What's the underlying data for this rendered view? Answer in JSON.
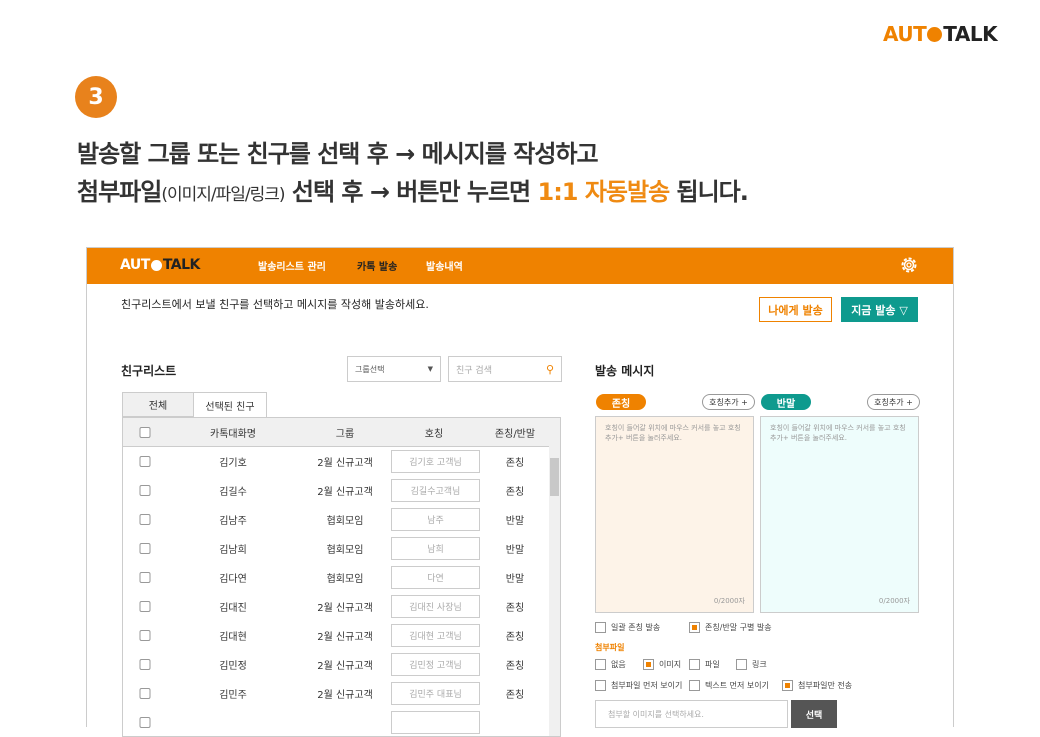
{
  "brand": {
    "logo_left": "AUT",
    "logo_right": "TALK"
  },
  "step": "3",
  "headline": {
    "line1": "발송할 그룹 또는 친구를 선택 후 → 메시지를 작성하고",
    "line2_a": "첨부파일",
    "line2_small": "(이미지/파일/링크)",
    "line2_b": " 선택 후 → 버튼만 누르면 ",
    "line2_highlight": "1:1 자동발송",
    "line2_c": " 됩니다."
  },
  "app": {
    "nav": [
      {
        "label": "발송리스트 관리"
      },
      {
        "label": "카톡 발송"
      },
      {
        "label": "발송내역"
      }
    ],
    "instruction": "친구리스트에서 보낼 친구를 선택하고 메시지를 작성해 발송하세요.",
    "send_me_label": "나에게 발송",
    "send_now_label": "지금 발송 ▽",
    "friend_list": {
      "title": "친구리스트",
      "group_select": "그룹선택",
      "search_placeholder": "친구 검색",
      "tabs": [
        {
          "label": "전체"
        },
        {
          "label": "선택된 친구"
        }
      ],
      "columns": [
        "카톡대화명",
        "그룹",
        "호칭",
        "존칭/반말"
      ],
      "rows": [
        {
          "name": "김기호",
          "group": "2월 신규고객",
          "honorific": "김기호 고객님",
          "tone": "존칭"
        },
        {
          "name": "김길수",
          "group": "2월 신규고객",
          "honorific": "김길수고객님",
          "tone": "존칭"
        },
        {
          "name": "김남주",
          "group": "협회모임",
          "honorific": "남주",
          "tone": "반말"
        },
        {
          "name": "김남희",
          "group": "협회모임",
          "honorific": "남희",
          "tone": "반말"
        },
        {
          "name": "김다연",
          "group": "협회모임",
          "honorific": "다연",
          "tone": "반말"
        },
        {
          "name": "김대진",
          "group": "2월 신규고객",
          "honorific": "김대진 사장님",
          "tone": "존칭"
        },
        {
          "name": "김대현",
          "group": "2월 신규고객",
          "honorific": "김대현 고객님",
          "tone": "존칭"
        },
        {
          "name": "김민정",
          "group": "2월 신규고객",
          "honorific": "김민정 고객님",
          "tone": "존칭"
        },
        {
          "name": "김민주",
          "group": "2월 신규고객",
          "honorific": "김민주 대표님",
          "tone": "존칭"
        }
      ]
    },
    "message": {
      "title": "발송 메시지",
      "formal_label": "존칭",
      "casual_label": "반말",
      "add_honorific": "호칭추가 +",
      "placeholder": "호칭이 들어갈 위치에 마우스 커서를 놓고 호칭추가+ 버튼을 눌러주세요.",
      "counter": "0/2000자",
      "send_options": [
        {
          "label": "일괄 존칭 발송",
          "checked": false
        },
        {
          "label": "존칭/반말 구별 발송",
          "checked": true
        }
      ],
      "attach_title": "첨부파일",
      "attach_types": [
        {
          "label": "없음",
          "checked": false
        },
        {
          "label": "이미지",
          "checked": true
        },
        {
          "label": "파일",
          "checked": false
        },
        {
          "label": "링크",
          "checked": false
        }
      ],
      "order_options": [
        {
          "label": "첨부파일 먼저 보이기",
          "checked": false
        },
        {
          "label": "텍스트 먼저 보이기",
          "checked": false
        },
        {
          "label": "첨부파일만 전송",
          "checked": true
        }
      ],
      "file_placeholder": "첨부할 이미지를 선택하세요.",
      "select_label": "선택"
    }
  },
  "colors": {
    "accent": "#EF8200",
    "teal": "#0E9A8E"
  }
}
